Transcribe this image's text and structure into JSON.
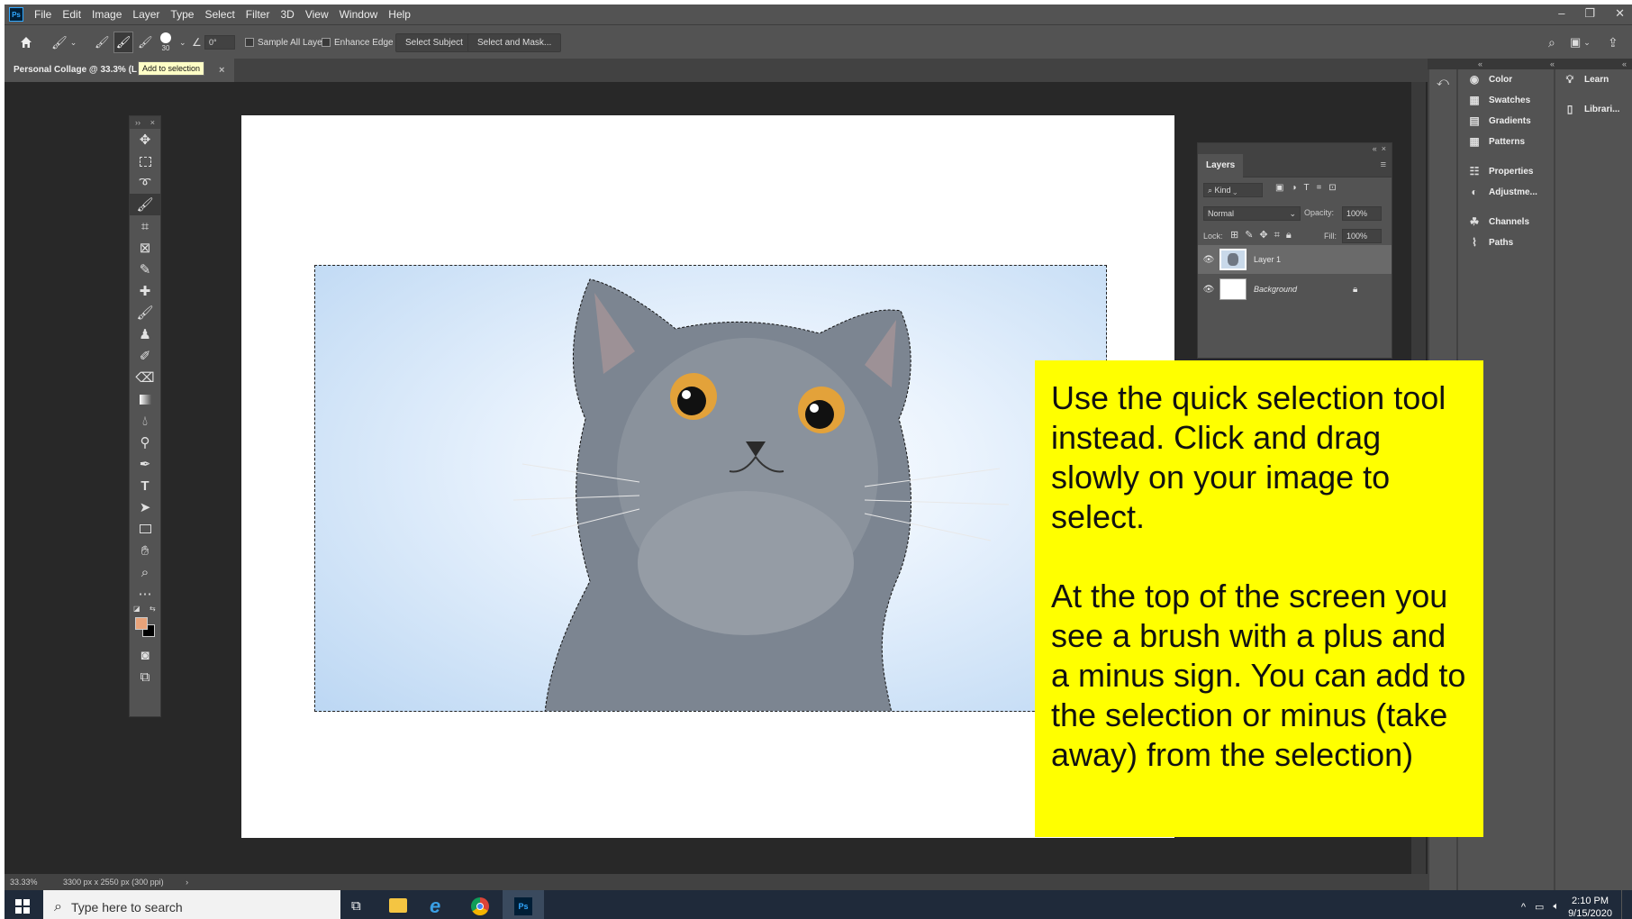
{
  "app": {
    "logo": "Ps",
    "menu": [
      "File",
      "Edit",
      "Image",
      "Layer",
      "Type",
      "Select",
      "Filter",
      "3D",
      "View",
      "Window",
      "Help"
    ]
  },
  "options": {
    "brush_size": "30",
    "angle": "0°",
    "sample_all_layers": "Sample All Layers",
    "enhance_edge": "Enhance Edge",
    "select_subject": "Select Subject",
    "select_and_mask": "Select and Mask..."
  },
  "document": {
    "tab_title": "Personal Collage @ 33.3% (L",
    "tooltip": "Add to selection",
    "close": "×"
  },
  "right_panels": {
    "col1": [
      "Color",
      "Swatches",
      "Gradients",
      "Patterns",
      "Properties",
      "Adjustme...",
      "Channels",
      "Paths"
    ],
    "col2": [
      "Learn",
      "Librari..."
    ]
  },
  "layers_panel": {
    "tab": "Layers",
    "filter_kind": "Kind",
    "blend_mode": "Normal",
    "opacity_label": "Opacity:",
    "opacity_value": "100%",
    "lock_label": "Lock:",
    "fill_label": "Fill:",
    "fill_value": "100%",
    "layers": [
      {
        "name": "Layer 1",
        "selected": true
      },
      {
        "name": "Background",
        "selected": false
      }
    ]
  },
  "instruction": {
    "paragraph1": "Use the quick selection tool instead. Click and drag slowly on your image to select.",
    "paragraph2": "At the top of the screen you see a brush with a plus and a minus sign. You can add to the selection or minus (take away) from the selection)"
  },
  "status": {
    "zoom": "33.33%",
    "doc_size": "3300 px x 2550 px (300 ppi)"
  },
  "taskbar": {
    "search_placeholder": "Type here to search",
    "ps_label": "Ps",
    "time": "2:10 PM",
    "date": "9/15/2020"
  },
  "colors": {
    "foreground": "#e8a37a",
    "background": "#000000",
    "instruction_bg": "#ffff00"
  }
}
